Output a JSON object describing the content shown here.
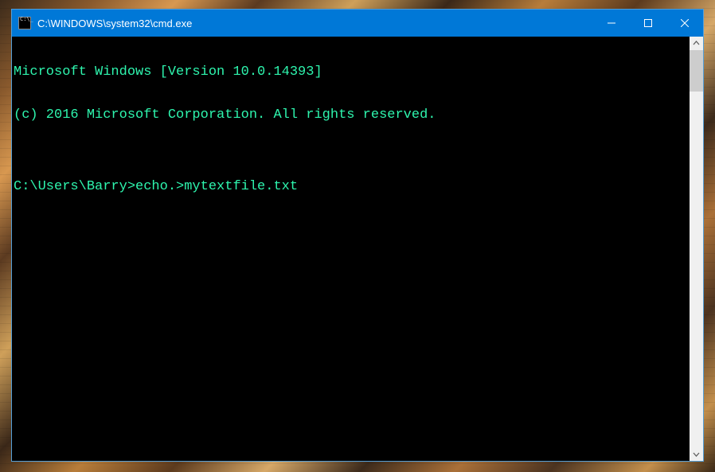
{
  "window": {
    "title": "C:\\WINDOWS\\system32\\cmd.exe"
  },
  "console": {
    "lines": [
      "Microsoft Windows [Version 10.0.14393]",
      "(c) 2016 Microsoft Corporation. All rights reserved.",
      "",
      "C:\\Users\\Barry>echo.>mytextfile.txt",
      ""
    ]
  }
}
